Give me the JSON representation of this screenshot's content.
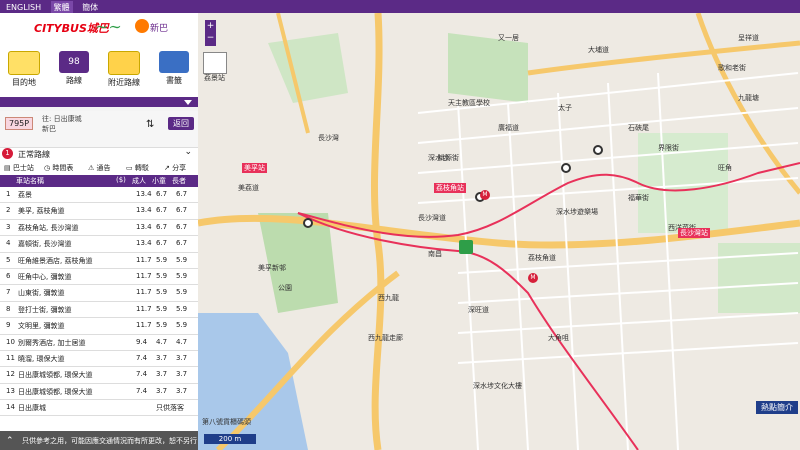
{
  "topbar": {
    "lang1": "ENGLISH",
    "lang2": "繁體",
    "lang3": "簡体"
  },
  "panel": {
    "logos": {
      "a": "CITYBUS城巴",
      "b": "",
      "c": "新巴"
    },
    "modes": [
      {
        "label": "目的地"
      },
      {
        "label": "路線",
        "badge": "98"
      },
      {
        "label": "附近路線"
      },
      {
        "label": "書籤"
      }
    ],
    "route": {
      "number": "795P",
      "to_prefix": "往: 日出康城",
      "operator": "新巴",
      "back": "返回"
    },
    "direction": {
      "index": "1",
      "label": "正常路線"
    },
    "tools": [
      "巴士站",
      "時間表",
      "通告",
      "轉駁",
      "分享"
    ],
    "table": {
      "headers": {
        "station": "車站名稱",
        "fare": "($)",
        "adult": "成人",
        "child": "小童",
        "senior": "長者"
      },
      "rows": [
        {
          "no": "1",
          "name": "荔景",
          "adult": "13.4",
          "child": "6.7",
          "senior": "6.7"
        },
        {
          "no": "2",
          "name": "美孚, 荔枝角道",
          "adult": "13.4",
          "child": "6.7",
          "senior": "6.7"
        },
        {
          "no": "3",
          "name": "荔枝角站, 長沙灣道",
          "adult": "13.4",
          "child": "6.7",
          "senior": "6.7"
        },
        {
          "no": "4",
          "name": "嘉頓街, 長沙灣道",
          "adult": "13.4",
          "child": "6.7",
          "senior": "6.7"
        },
        {
          "no": "5",
          "name": "旺角維景酒店, 荔枝角道",
          "adult": "11.7",
          "child": "5.9",
          "senior": "5.9"
        },
        {
          "no": "6",
          "name": "旺角中心, 彌敦道",
          "adult": "11.7",
          "child": "5.9",
          "senior": "5.9"
        },
        {
          "no": "7",
          "name": "山東街, 彌敦道",
          "adult": "11.7",
          "child": "5.9",
          "senior": "5.9"
        },
        {
          "no": "8",
          "name": "登打士街, 彌敦道",
          "adult": "11.7",
          "child": "5.9",
          "senior": "5.9"
        },
        {
          "no": "9",
          "name": "文明里, 彌敦道",
          "adult": "11.7",
          "child": "5.9",
          "senior": "5.9"
        },
        {
          "no": "10",
          "name": "別爾秀酒店, 加士居道",
          "adult": "9.4",
          "child": "4.7",
          "senior": "4.7"
        },
        {
          "no": "11",
          "name": "曉溜, 環保大道",
          "adult": "7.4",
          "child": "3.7",
          "senior": "3.7"
        },
        {
          "no": "12",
          "name": "日出康城領都, 環保大道",
          "adult": "7.4",
          "child": "3.7",
          "senior": "3.7"
        },
        {
          "no": "13",
          "name": "日出康城領都, 環保大道",
          "adult": "7.4",
          "child": "3.7",
          "senior": "3.7"
        },
        {
          "no": "14",
          "name": "日出康城",
          "adult": "",
          "child": "只供落客",
          "senior": ""
        }
      ]
    },
    "note": "只供參考之用，可能因應交通情況而有所更改，恕不另行"
  },
  "map": {
    "scale": "200 m",
    "hotspots": "熱點簡介",
    "labels": [
      {
        "t": "大埔道"
      },
      {
        "t": "又一居"
      },
      {
        "t": "歌和老街"
      },
      {
        "t": "桃源街"
      },
      {
        "t": "長沙灣道"
      },
      {
        "t": "深水埗遊樂場"
      },
      {
        "t": "荔枝角道"
      },
      {
        "t": "旺角"
      },
      {
        "t": "九龍塘"
      },
      {
        "t": "界限街"
      },
      {
        "t": "美孚新邨"
      },
      {
        "t": "西九龍走廊"
      },
      {
        "t": "深水埗"
      },
      {
        "t": "南昌"
      },
      {
        "t": "天主教區學校"
      },
      {
        "t": "太子"
      },
      {
        "t": "西洋菜街"
      },
      {
        "t": "深旺道"
      },
      {
        "t": "西九龍"
      },
      {
        "t": "深水埗文化大樓"
      },
      {
        "t": "長沙灣"
      },
      {
        "t": "大角咀"
      },
      {
        "t": "福華街"
      },
      {
        "t": "公園"
      },
      {
        "t": "石硤尾"
      },
      {
        "t": "呈祥道"
      },
      {
        "t": "廣福道"
      },
      {
        "t": "美荔道"
      },
      {
        "t": "第八號貨櫃碼頭"
      },
      {
        "t": "荔景站"
      }
    ],
    "stops": [
      {
        "label": "荔枝角站"
      },
      {
        "label": "美孚站"
      },
      {
        "label": "長沙灣站"
      }
    ]
  }
}
